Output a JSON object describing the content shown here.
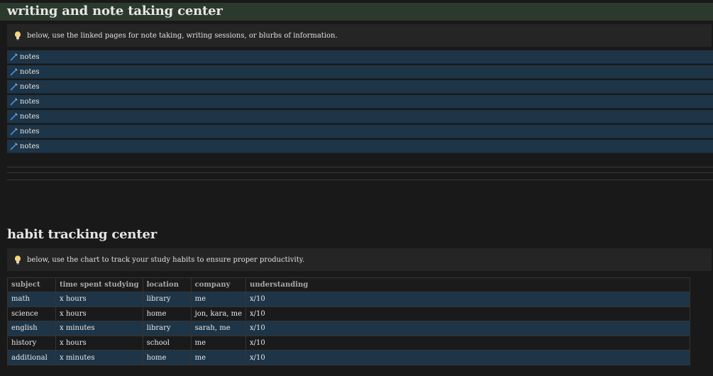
{
  "writing": {
    "title": "writing and note taking center",
    "callout_icon": "lightbulb-icon",
    "callout_text": "below, use the linked pages for note taking, writing sessions, or blurbs of information.",
    "notes": [
      {
        "label": "notes",
        "icon": "pencil-icon"
      },
      {
        "label": "notes",
        "icon": "pencil-icon"
      },
      {
        "label": "notes",
        "icon": "pencil-icon"
      },
      {
        "label": "notes",
        "icon": "pencil-icon"
      },
      {
        "label": "notes",
        "icon": "pencil-icon"
      },
      {
        "label": "notes",
        "icon": "pencil-icon"
      },
      {
        "label": "notes",
        "icon": "pencil-icon"
      }
    ]
  },
  "habit": {
    "title": "habit tracking center",
    "callout_icon": "lightbulb-icon",
    "callout_text": "below, use the chart to track your study habits to ensure proper productivity.",
    "columns": [
      "subject",
      "time spent studying",
      "location",
      "company",
      "understanding"
    ],
    "rows": [
      [
        "math",
        "x hours",
        "library",
        "me",
        "x/10"
      ],
      [
        "science",
        "x hours",
        "home",
        "jon, kara, me",
        "x/10"
      ],
      [
        "english",
        "x minutes",
        "library",
        "sarah, me",
        "x/10"
      ],
      [
        "history",
        "x hours",
        "school",
        "me",
        "x/10"
      ],
      [
        "additional",
        "x minutes",
        "home",
        "me",
        "x/10"
      ]
    ]
  },
  "colors": {
    "background": "#191919",
    "heading_bar": "#2c3a2e",
    "link_row": "#1e3547",
    "callout": "#252525"
  }
}
